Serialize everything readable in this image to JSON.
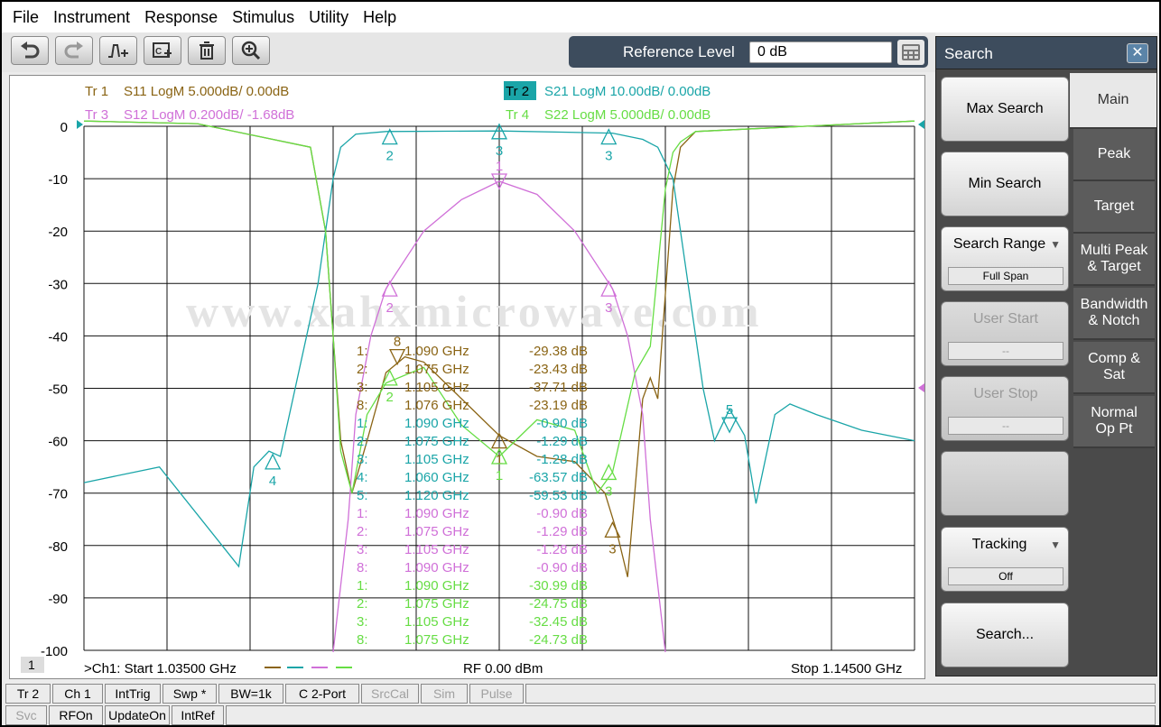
{
  "menu": [
    "File",
    "Instrument",
    "Response",
    "Stimulus",
    "Utility",
    "Help"
  ],
  "reference_level": {
    "label": "Reference Level",
    "value": "0 dB"
  },
  "traces": [
    {
      "label": "Tr 1",
      "desc": "S11 LogM 5.000dB/  0.00dB",
      "color": "#8a6414"
    },
    {
      "label": "Tr 2",
      "desc": "S21 LogM 10.00dB/  0.00dB",
      "color": "#1aa5a8"
    },
    {
      "label": "Tr 3",
      "desc": "S12 LogM 0.200dB/  -1.68dB",
      "color": "#d070d8"
    },
    {
      "label": "Tr 4",
      "desc": "S22 LogM 5.000dB/  0.00dB",
      "color": "#66dd44"
    }
  ],
  "watermark": "www.xahxmicrowave.com",
  "y_ticks": [
    "0",
    "-10",
    "-20",
    "-30",
    "-40",
    "-50",
    "-60",
    "-70",
    "-80",
    "-90",
    "-100"
  ],
  "marker_table": [
    {
      "id": "1:",
      "freq": "1.090  GHz",
      "val": "-29.38 dB",
      "color": "#8a6414"
    },
    {
      "id": "2:",
      "freq": "1.075  GHz",
      "val": "-23.43 dB",
      "color": "#8a6414"
    },
    {
      "id": "3:",
      "freq": "1.105  GHz",
      "val": "-37.71 dB",
      "color": "#8a6414"
    },
    {
      "id": "8:",
      "freq": "1.076  GHz",
      "val": "-23.19 dB",
      "color": "#8a6414"
    },
    {
      "id": "1:",
      "freq": "1.090  GHz",
      "val": "-0.90 dB",
      "color": "#1aa5a8"
    },
    {
      "id": "2:",
      "freq": "1.075  GHz",
      "val": "-1.29 dB",
      "color": "#1aa5a8"
    },
    {
      "id": "3:",
      "freq": "1.105  GHz",
      "val": "-1.28 dB",
      "color": "#1aa5a8"
    },
    {
      "id": "4:",
      "freq": "1.060  GHz",
      "val": "-63.57 dB",
      "color": "#1aa5a8"
    },
    {
      "id": "5:",
      "freq": "1.120  GHz",
      "val": "-59.53 dB",
      "color": "#1aa5a8"
    },
    {
      "id": "1:",
      "freq": "1.090  GHz",
      "val": "-0.90 dB",
      "color": "#d070d8"
    },
    {
      "id": "2:",
      "freq": "1.075  GHz",
      "val": "-1.29 dB",
      "color": "#d070d8"
    },
    {
      "id": "3:",
      "freq": "1.105  GHz",
      "val": "-1.28 dB",
      "color": "#d070d8"
    },
    {
      "id": "8:",
      "freq": "1.090  GHz",
      "val": "-0.90 dB",
      "color": "#d070d8"
    },
    {
      "id": "1:",
      "freq": "1.090  GHz",
      "val": "-30.99 dB",
      "color": "#66dd44"
    },
    {
      "id": "2:",
      "freq": "1.075  GHz",
      "val": "-24.75 dB",
      "color": "#66dd44"
    },
    {
      "id": "3:",
      "freq": "1.105  GHz",
      "val": "-32.45 dB",
      "color": "#66dd44"
    },
    {
      "id": "8:",
      "freq": "1.075  GHz",
      "val": "-24.73 dB",
      "color": "#66dd44"
    }
  ],
  "channel_badge": "1",
  "footer": {
    "start": ">Ch1:  Start   1.03500 GHz",
    "rf": "RF    0.00 dBm",
    "stop": "Stop  1.14500 GHz"
  },
  "status_row1": [
    {
      "label": "Tr 2",
      "w": 50,
      "disabled": false
    },
    {
      "label": "Ch 1",
      "w": 56,
      "disabled": false
    },
    {
      "label": "IntTrig",
      "w": 62,
      "disabled": false
    },
    {
      "label": "Swp *",
      "w": 60,
      "disabled": false
    },
    {
      "label": "BW=1k",
      "w": 72,
      "disabled": false
    },
    {
      "label": "C  2-Port",
      "w": 82,
      "disabled": false
    },
    {
      "label": "SrcCal",
      "w": 64,
      "disabled": true
    },
    {
      "label": "Sim",
      "w": 52,
      "disabled": true
    },
    {
      "label": "Pulse",
      "w": 60,
      "disabled": true
    }
  ],
  "status_row2": [
    {
      "label": "Svc",
      "w": 46,
      "disabled": true
    },
    {
      "label": "RFOn",
      "w": 60,
      "disabled": false
    },
    {
      "label": "UpdateOn",
      "w": 72,
      "disabled": false
    },
    {
      "label": "IntRef",
      "w": 58,
      "disabled": false
    }
  ],
  "side": {
    "title": "Search",
    "buttons": {
      "max_search": "Max Search",
      "min_search": "Min Search",
      "search_range": "Search Range",
      "search_range_value": "Full Span",
      "user_start": "User Start",
      "user_start_value": "--",
      "user_stop": "User Stop",
      "user_stop_value": "--",
      "tracking": "Tracking",
      "tracking_value": "Off",
      "search_more": "Search..."
    },
    "tabs": [
      "Main",
      "Peak",
      "Target",
      "Multi Peak & Target",
      "Bandwidth & Notch",
      "Comp & Sat",
      "Normal Op Pt"
    ]
  },
  "chart_data": {
    "type": "line",
    "x_range_ghz": [
      1.035,
      1.145
    ],
    "ylim": [
      -100,
      0
    ],
    "y_ticks": [
      0,
      -10,
      -20,
      -30,
      -40,
      -50,
      -60,
      -70,
      -80,
      -90,
      -100
    ],
    "grid": true,
    "series": [
      {
        "name": "S11",
        "color": "#8a6414",
        "x": [
          1.035,
          1.05,
          1.065,
          1.067,
          1.068,
          1.069,
          1.0705,
          1.0725,
          1.075,
          1.0775,
          1.08,
          1.085,
          1.09,
          1.095,
          1.1,
          1.104,
          1.1055,
          1.107,
          1.109,
          1.11,
          1.111,
          1.113,
          1.114,
          1.116,
          1.145
        ],
        "y": [
          1,
          0.5,
          -4,
          -20,
          -40,
          -60,
          -70,
          -60,
          -47,
          -44,
          -45,
          -52,
          -59,
          -63,
          -64,
          -70,
          -77,
          -86,
          -52,
          -48,
          -52,
          -12,
          -4,
          -1,
          1
        ]
      },
      {
        "name": "S21",
        "color": "#1aa5a8",
        "x": [
          1.035,
          1.045,
          1.0555,
          1.0575,
          1.0595,
          1.061,
          1.066,
          1.068,
          1.069,
          1.071,
          1.075,
          1.09,
          1.105,
          1.109,
          1.111,
          1.113,
          1.115,
          1.117,
          1.1185,
          1.1205,
          1.1225,
          1.124,
          1.1265,
          1.1285,
          1.132,
          1.138,
          1.145
        ],
        "y": [
          -68,
          -65,
          -84,
          -65,
          -62,
          -63,
          -30,
          -10,
          -4,
          -1.5,
          -1,
          -0.9,
          -1.3,
          -2.5,
          -4,
          -10,
          -30,
          -50,
          -60,
          -54,
          -59,
          -72,
          -55,
          -53,
          -55,
          -58,
          -60
        ]
      },
      {
        "name": "S12",
        "color": "#d070d8",
        "x": [
          1.068,
          1.07,
          1.071,
          1.073,
          1.075,
          1.08,
          1.085,
          1.09,
          1.095,
          1.1,
          1.105,
          1.107,
          1.109,
          1.11,
          1.112
        ],
        "y": [
          -101,
          -75,
          -55,
          -40,
          -31,
          -20,
          -14,
          -10.5,
          -13,
          -20,
          -31,
          -40,
          -55,
          -75,
          -101
        ]
      },
      {
        "name": "S22",
        "color": "#66dd44",
        "x": [
          1.035,
          1.05,
          1.065,
          1.067,
          1.068,
          1.069,
          1.0705,
          1.0725,
          1.075,
          1.08,
          1.085,
          1.09,
          1.095,
          1.1,
          1.103,
          1.105,
          1.108,
          1.11,
          1.112,
          1.113,
          1.114,
          1.116,
          1.145
        ],
        "y": [
          1,
          0.5,
          -4,
          -20,
          -40,
          -62,
          -70,
          -55,
          -49,
          -46,
          -57,
          -63,
          -56,
          -58,
          -70,
          -66,
          -47,
          -42,
          -12,
          -5,
          -3,
          -1,
          1
        ]
      }
    ],
    "markers": [
      {
        "label": "2",
        "x": 1.0755,
        "y": -2,
        "color": "#1aa5a8",
        "dir": "up"
      },
      {
        "label": "3",
        "x": 1.09,
        "y": -1,
        "color": "#1aa5a8",
        "dir": "up"
      },
      {
        "label": "3",
        "x": 1.1045,
        "y": -2,
        "color": "#1aa5a8",
        "dir": "up"
      },
      {
        "label": "4",
        "x": 1.06,
        "y": -64,
        "color": "#1aa5a8",
        "dir": "up"
      },
      {
        "label": "5",
        "x": 1.1205,
        "y": -57,
        "color": "#1aa5a8",
        "dir": "down"
      },
      {
        "label": "1",
        "x": 1.09,
        "y": -10.5,
        "color": "#d070d8",
        "dir": "down"
      },
      {
        "label": "2",
        "x": 1.0755,
        "y": -31,
        "color": "#d070d8",
        "dir": "up"
      },
      {
        "label": "3",
        "x": 1.1045,
        "y": -31,
        "color": "#d070d8",
        "dir": "up"
      },
      {
        "label": "8",
        "x": 1.0765,
        "y": -44,
        "color": "#8a6414",
        "dir": "down"
      },
      {
        "label": "3",
        "x": 1.105,
        "y": -77,
        "color": "#8a6414",
        "dir": "up"
      },
      {
        "label": "1",
        "x": 1.09,
        "y": -60,
        "color": "#8a6414",
        "dir": "up"
      },
      {
        "label": "2",
        "x": 1.0755,
        "y": -48,
        "color": "#66dd44",
        "dir": "up"
      },
      {
        "label": "1",
        "x": 1.09,
        "y": -63,
        "color": "#66dd44",
        "dir": "up"
      },
      {
        "label": "3",
        "x": 1.1045,
        "y": -66,
        "color": "#66dd44",
        "dir": "up"
      }
    ]
  }
}
